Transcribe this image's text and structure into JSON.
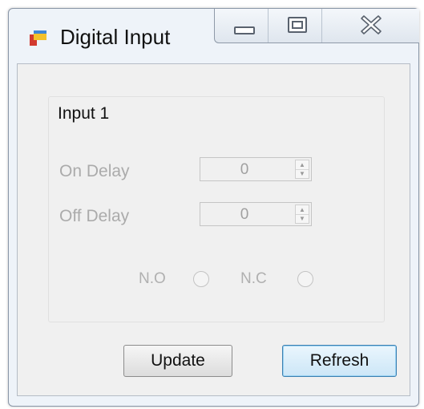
{
  "window": {
    "title": "Digital Input",
    "icon": "app-icon"
  },
  "caption_buttons": {
    "minimize": "minimize-icon",
    "maximize": "maximize-icon",
    "close": "close-icon",
    "close_glyph": "☒"
  },
  "group": {
    "title": "Input 1"
  },
  "fields": {
    "on_delay_label": "On Delay",
    "on_delay_value": "0",
    "off_delay_label": "Off Delay",
    "off_delay_value": "0",
    "spin_up": "▲",
    "spin_down": "▼"
  },
  "radios": {
    "no_label": "N.O",
    "nc_label": "N.C"
  },
  "buttons": {
    "update_label": "Update",
    "refresh_label": "Refresh"
  },
  "colors": {
    "disabled_text": "#ababab",
    "focus_border": "#3c7fb1"
  }
}
